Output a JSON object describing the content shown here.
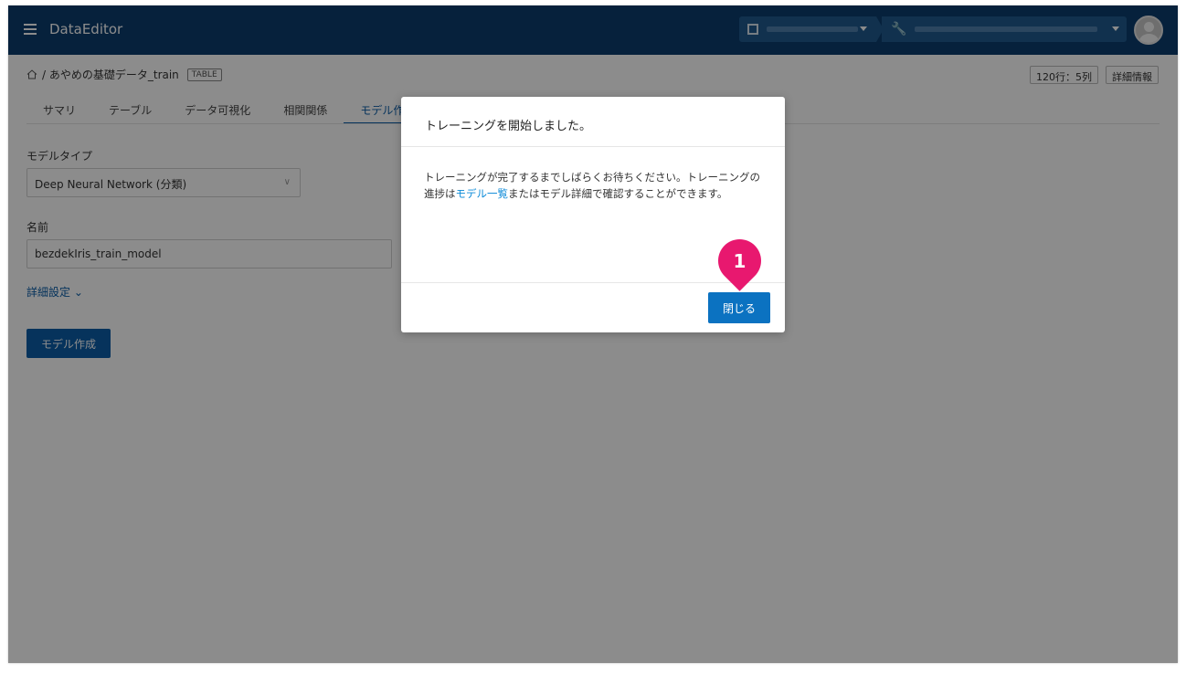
{
  "app": {
    "title": "DataEditor"
  },
  "breadcrumb": {
    "path": "/ あやめの基礎データ_train",
    "tag": "TABLE"
  },
  "header_buttons": {
    "rows_cols": "120行：5列",
    "details": "詳細情報"
  },
  "tabs": [
    {
      "label": "サマリ",
      "active": false
    },
    {
      "label": "テーブル",
      "active": false
    },
    {
      "label": "データ可視化",
      "active": false
    },
    {
      "label": "相関関係",
      "active": false
    },
    {
      "label": "モデル作",
      "active": true
    }
  ],
  "form": {
    "model_type_label": "モデルタイプ",
    "model_type_value": "Deep Neural Network (分類)",
    "name_label": "名前",
    "name_value": "bezdekIris_train_model",
    "advanced_label": "詳細設定",
    "create_button": "モデル作成"
  },
  "modal": {
    "title": "トレーニングを開始しました。",
    "body_part1": "トレーニングが完了するまでしばらくお待ちください。トレーニングの進捗は",
    "body_link": "モデル一覧",
    "body_part2": "またはモデル詳細で確認することができます。",
    "close_button": "閉じる"
  },
  "step_marker": {
    "number": "1"
  },
  "colors": {
    "header": "#0b3d6e",
    "primary": "#0b5ea8",
    "link": "#0b8ad8",
    "marker": "#e8186f"
  }
}
